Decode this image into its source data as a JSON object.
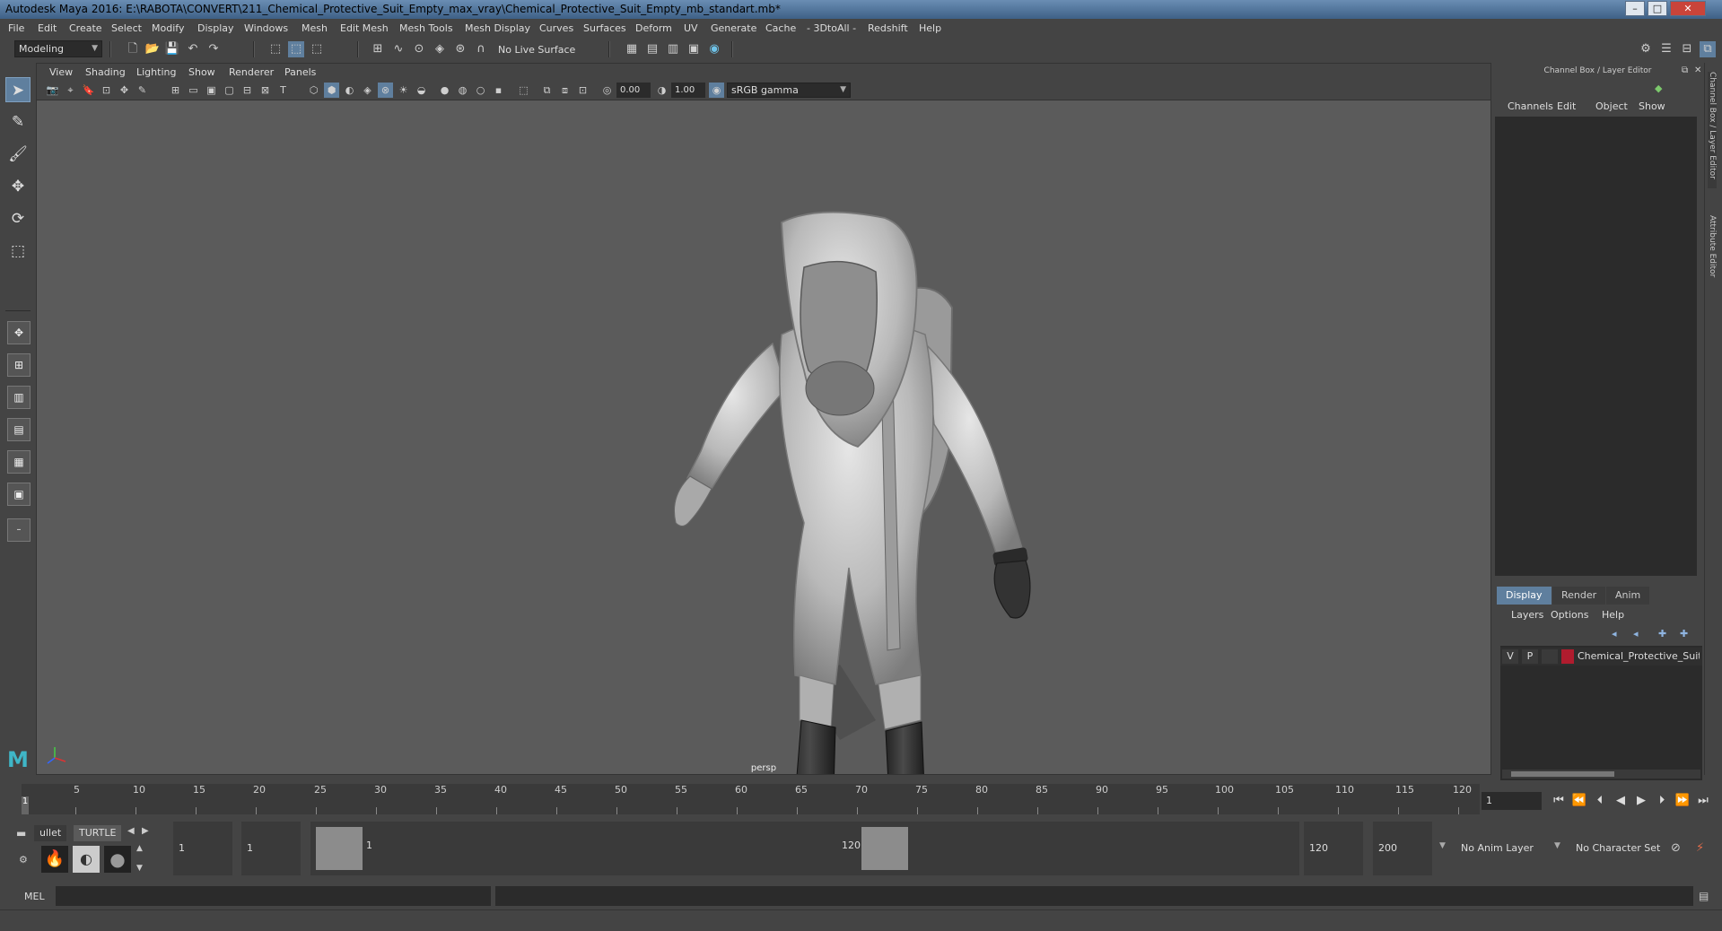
{
  "window": {
    "title": "Autodesk Maya 2016: E:\\RABOTA\\CONVERT\\211_Chemical_Protective_Suit_Empty_max_vray\\Chemical_Protective_Suit_Empty_mb_standart.mb*",
    "minimize": "–",
    "maximize": "□",
    "close": "✕"
  },
  "menubar": [
    "File",
    "Edit",
    "Create",
    "Select",
    "Modify",
    "Display",
    "Windows",
    "Mesh",
    "Edit Mesh",
    "Mesh Tools",
    "Mesh Display",
    "Curves",
    "Surfaces",
    "Deform",
    "UV",
    "Generate",
    "Cache",
    "- 3DtoAll -",
    "Redshift",
    "Help"
  ],
  "statusline": {
    "menuset": "Modeling",
    "live_surface": "No Live Surface"
  },
  "viewport": {
    "menu": [
      "View",
      "Shading",
      "Lighting",
      "Show",
      "Renderer",
      "Panels"
    ],
    "exposure": "0.00",
    "gamma": "1.00",
    "color_space": "sRGB gamma",
    "camera_label": "persp"
  },
  "channel_box": {
    "header": "Channel Box / Layer Editor",
    "menu": [
      "Channels",
      "Edit",
      "Object",
      "Show"
    ],
    "side_tabs": [
      "Channel Box / Layer Editor",
      "Attribute Editor"
    ]
  },
  "layer_editor": {
    "tabs": [
      "Display",
      "Render",
      "Anim"
    ],
    "menu": [
      "Layers",
      "Options",
      "Help"
    ],
    "layers": [
      {
        "visible": "V",
        "playback": "P",
        "color": "#b01c2e",
        "name": "Chemical_Protective_Suit"
      }
    ]
  },
  "timeline": {
    "ticks": [
      "5",
      "10",
      "15",
      "20",
      "25",
      "30",
      "35",
      "40",
      "45",
      "50",
      "55",
      "60",
      "65",
      "70",
      "75",
      "80",
      "85",
      "90",
      "95",
      "100",
      "105",
      "110",
      "115",
      "120"
    ],
    "current_frame_marker": "1",
    "current_frame": "1"
  },
  "range": {
    "start_time": "1",
    "playback_start": "1",
    "range_start_label": "1",
    "range_end_label": "120",
    "playback_end": "120",
    "end_time": "200",
    "anim_layer": "No Anim Layer",
    "character_set": "No Character Set"
  },
  "shelf": {
    "tabs": [
      "ullet",
      "TURTLE"
    ]
  },
  "command_line": {
    "label": "MEL"
  },
  "colors": {
    "accent": "#5f7f9e",
    "layer_color": "#b01c2e"
  }
}
